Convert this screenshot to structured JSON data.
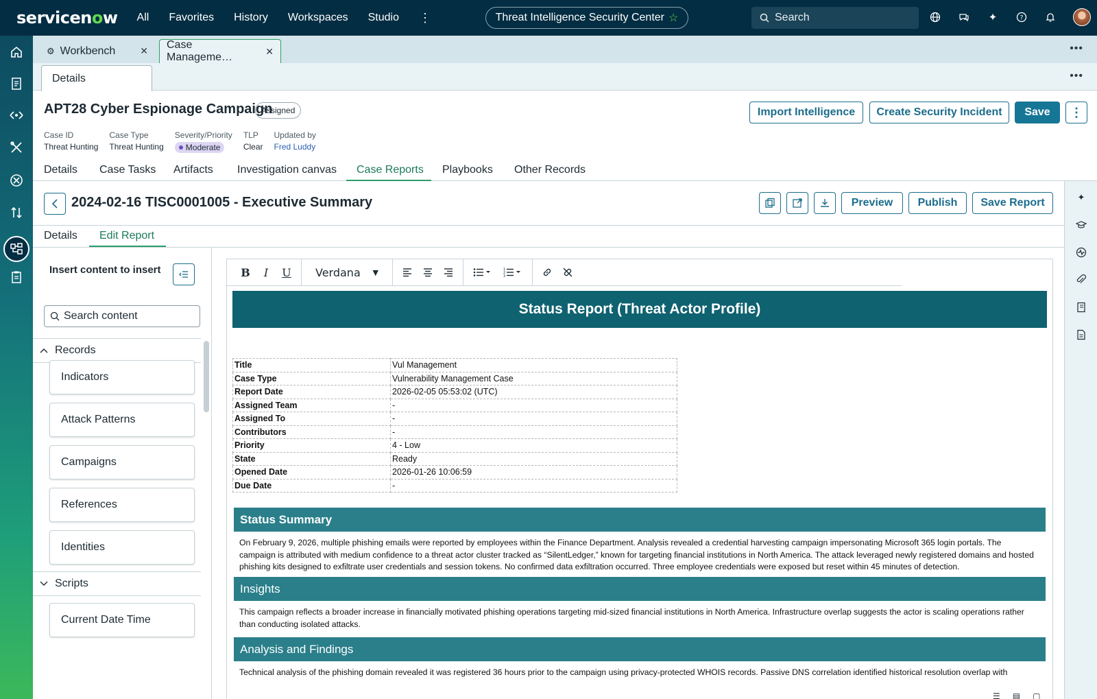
{
  "topnav": {
    "logo_pre": "servicen",
    "logo_o": "o",
    "logo_post": "w",
    "links": [
      "All",
      "Favorites",
      "History",
      "Workspaces",
      "Studio"
    ],
    "app_name": "Threat Intelligence Security Center",
    "search_placeholder": "Search"
  },
  "tabs": {
    "workbench": "Workbench",
    "case_mgmt": "Case Manageme…",
    "details_subtab": "Details"
  },
  "record": {
    "title": "APT28 Cyber Espionage Campaign",
    "status": "Assigned",
    "fields": [
      {
        "label": "Case ID",
        "value": "Threat Hunting"
      },
      {
        "label": "Case Type",
        "value": "Threat Hunting"
      },
      {
        "label": "Severity/Priority",
        "value": "Moderate"
      },
      {
        "label": "TLP",
        "value": "Clear"
      },
      {
        "label": "Updated by",
        "value": "Fred Luddy"
      }
    ],
    "buttons": {
      "import": "Import Intelligence",
      "create_incident": "Create Security Incident",
      "save": "Save"
    },
    "tabs": [
      "Details",
      "Case Tasks",
      "Artifacts",
      "Investigation canvas",
      "Case Reports",
      "Playbooks",
      "Other Records"
    ]
  },
  "report": {
    "title": "2024-02-16 TISC0001005 - Executive Summary",
    "buttons": {
      "preview": "Preview",
      "publish": "Publish",
      "save_report": "Save Report"
    },
    "tabs": [
      "Details",
      "Edit Report"
    ]
  },
  "left_panel": {
    "title": "Insert content to insert",
    "search_placeholder": "Search content",
    "records_label": "Records",
    "records": [
      "Indicators",
      "Attack Patterns",
      "Campaigns",
      "References",
      "Identities"
    ],
    "scripts_label": "Scripts",
    "scripts": [
      "Current Date Time"
    ]
  },
  "editor": {
    "font": "Verdana"
  },
  "document": {
    "heading": "Status Report (Threat Actor Profile)",
    "meta": [
      {
        "k": "Title",
        "v": "Vul Management"
      },
      {
        "k": "Case Type",
        "v": "Vulnerability Management Case"
      },
      {
        "k": "Report Date",
        "v": "2026-02-05 05:53:02 (UTC)"
      },
      {
        "k": "Assigned Team",
        "v": "-"
      },
      {
        "k": "Assigned To",
        "v": "-"
      },
      {
        "k": "Contributors",
        "v": "-"
      },
      {
        "k": "Priority",
        "v": "4 - Low"
      },
      {
        "k": "State",
        "v": "Ready"
      },
      {
        "k": "Opened Date",
        "v": "2026-01-26 10:06:59"
      },
      {
        "k": "Due Date",
        "v": "-"
      }
    ],
    "sections": [
      {
        "title": "Status Summary",
        "text": "On February 9, 2026, multiple phishing emails were reported by employees within the Finance Department. Analysis revealed a credential harvesting campaign impersonating Microsoft 365 login portals. The campaign is attributed with medium confidence to a threat actor cluster tracked as “SilentLedger,” known for targeting financial institutions in North America. The attack leveraged newly registered domains and hosted phishing kits designed to exfiltrate user credentials and session tokens. No confirmed data exfiltration occurred. Three employee credentials were exposed but reset within 45 minutes of detection."
      },
      {
        "title": "Insights",
        "text": "This campaign reflects a broader increase in financially motivated phishing operations targeting mid-sized financial institutions in North America. Infrastructure overlap suggests the actor is scaling operations rather than conducting isolated attacks."
      },
      {
        "title": "Analysis and Findings",
        "text": "Technical analysis of the phishing domain revealed it was registered 36 hours prior to the campaign using privacy-protected WHOIS records. Passive DNS correlation identified historical resolution overlap with"
      }
    ]
  },
  "colors": {
    "nav_bg": "#032d42",
    "accent_green": "#62d84e",
    "primary_button": "#167696",
    "doc_header": "#0f6270",
    "section_bar": "#2a7f8a"
  }
}
